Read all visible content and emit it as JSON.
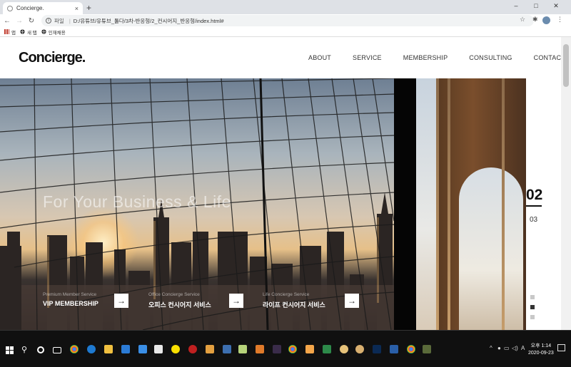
{
  "browser": {
    "tab_title": "Concierge.",
    "tab_close": "×",
    "new_tab": "+",
    "address_scheme": "파일",
    "address_path": "D:/유튜브/유튜브_툴다/3차-반응형/2_컨시어지_반응형/index.html#",
    "bookmarks": [
      {
        "label": "앱"
      },
      {
        "label": "새 탭"
      },
      {
        "label": "인재채용"
      }
    ]
  },
  "site": {
    "logo": "Concierge.",
    "nav": [
      "ABOUT",
      "SERVICE",
      "MEMBERSHIP",
      "CONSULTING",
      "CONTACT"
    ]
  },
  "hero": {
    "headline": "For Your Business & Life",
    "services": [
      {
        "sub": "Premium Member Service",
        "title": "VIP MEMBERSHIP"
      },
      {
        "sub": "Office Concierge Service",
        "title": "오피스 컨시어지 서비스"
      },
      {
        "sub": "Life Concierge Service",
        "title": "라이프 컨시어지 서비스"
      }
    ]
  },
  "pager": {
    "current": "02",
    "next": "03",
    "active_dot_index": 1
  },
  "taskbar": {
    "time": "오후 1:14",
    "date": "2020-09-23"
  }
}
